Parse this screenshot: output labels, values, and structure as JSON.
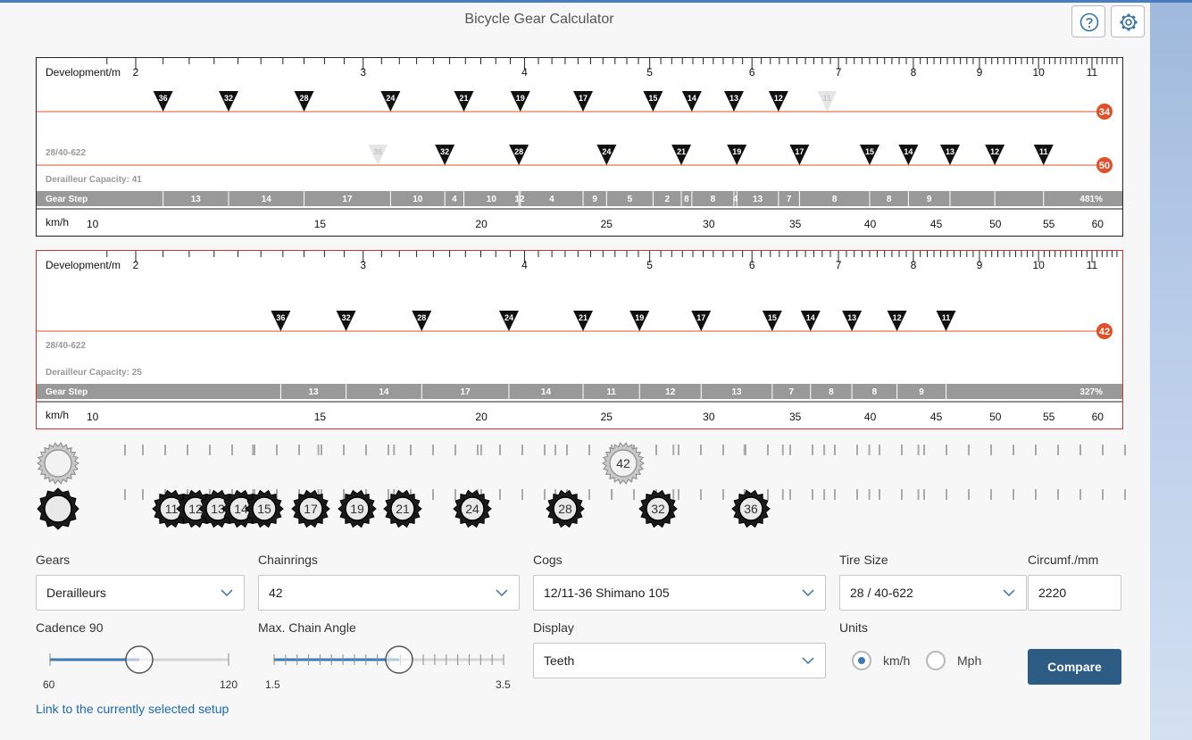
{
  "window": {
    "title": "Bicycle Gear Calculator"
  },
  "header": {
    "help_icon": "question-circle-icon",
    "settings_icon": "gear-icon"
  },
  "charts": [
    {
      "selected": false,
      "development_label": "Development/m",
      "development_ticks": [
        "2",
        "3",
        "4",
        "5",
        "6",
        "7",
        "8",
        "9",
        "10",
        "11"
      ],
      "rings": [
        {
          "label": "34",
          "cogs": [
            {
              "t": "36",
              "dev": 2.1,
              "faded": false
            },
            {
              "t": "32",
              "dev": 2.36,
              "faded": false
            },
            {
              "t": "28",
              "dev": 2.7,
              "faded": false
            },
            {
              "t": "24",
              "dev": 3.15,
              "faded": false
            },
            {
              "t": "21",
              "dev": 3.59,
              "faded": false
            },
            {
              "t": "19",
              "dev": 3.97,
              "faded": false
            },
            {
              "t": "17",
              "dev": 4.44,
              "faded": false
            },
            {
              "t": "15",
              "dev": 5.03,
              "faded": false
            },
            {
              "t": "14",
              "dev": 5.39,
              "faded": false
            },
            {
              "t": "13",
              "dev": 5.81,
              "faded": false
            },
            {
              "t": "12",
              "dev": 6.29,
              "faded": false
            },
            {
              "t": "11",
              "dev": 6.86,
              "faded": true
            }
          ]
        },
        {
          "label": "50",
          "cogs": [
            {
              "t": "36",
              "dev": 3.08,
              "faded": true
            },
            {
              "t": "32",
              "dev": 3.47,
              "faded": false
            },
            {
              "t": "28",
              "dev": 3.96,
              "faded": false
            },
            {
              "t": "24",
              "dev": 4.63,
              "faded": false
            },
            {
              "t": "21",
              "dev": 5.29,
              "faded": false
            },
            {
              "t": "19",
              "dev": 5.84,
              "faded": false
            },
            {
              "t": "17",
              "dev": 6.53,
              "faded": false
            },
            {
              "t": "15",
              "dev": 7.4,
              "faded": false
            },
            {
              "t": "14",
              "dev": 7.93,
              "faded": false
            },
            {
              "t": "13",
              "dev": 8.54,
              "faded": false
            },
            {
              "t": "12",
              "dev": 9.25,
              "faded": false
            },
            {
              "t": "11",
              "dev": 10.09,
              "faded": false
            }
          ]
        }
      ],
      "setup_label": "28/40-622",
      "capacity_label": "Derailleur Capacity: 41",
      "gear_step_label": "Gear Step",
      "gear_steps": [
        "13",
        "14",
        "17",
        "10",
        "4",
        "10",
        "12",
        "4",
        "9",
        "5",
        "2",
        "8",
        "8",
        "4",
        "13",
        "7",
        "8",
        "8",
        "9"
      ],
      "gear_step_total": "481%",
      "speed_label": "km/h",
      "speed_ticks": [
        "10",
        "15",
        "20",
        "25",
        "30",
        "35",
        "40",
        "45",
        "50",
        "55",
        "60"
      ]
    },
    {
      "selected": true,
      "development_label": "Development/m",
      "development_ticks": [
        "2",
        "3",
        "4",
        "5",
        "6",
        "7",
        "8",
        "9",
        "10",
        "11"
      ],
      "rings": [
        {
          "label": "42",
          "cogs": [
            {
              "t": "36",
              "dev": 2.59,
              "faded": false
            },
            {
              "t": "32",
              "dev": 2.91,
              "faded": false
            },
            {
              "t": "28",
              "dev": 3.33,
              "faded": false
            },
            {
              "t": "24",
              "dev": 3.89,
              "faded": false
            },
            {
              "t": "21",
              "dev": 4.44,
              "faded": false
            },
            {
              "t": "19",
              "dev": 4.91,
              "faded": false
            },
            {
              "t": "17",
              "dev": 5.48,
              "faded": false
            },
            {
              "t": "15",
              "dev": 6.22,
              "faded": false
            },
            {
              "t": "14",
              "dev": 6.66,
              "faded": false
            },
            {
              "t": "13",
              "dev": 7.17,
              "faded": false
            },
            {
              "t": "12",
              "dev": 7.77,
              "faded": false
            },
            {
              "t": "11",
              "dev": 8.48,
              "faded": false
            }
          ]
        }
      ],
      "setup_label": "28/40-622",
      "capacity_label": "Derailleur Capacity: 25",
      "gear_step_label": "Gear Step",
      "gear_steps": [
        "13",
        "14",
        "17",
        "14",
        "11",
        "12",
        "13",
        "7",
        "8",
        "8",
        "9"
      ],
      "gear_step_total": "327%",
      "speed_label": "km/h",
      "speed_ticks": [
        "10",
        "15",
        "20",
        "25",
        "30",
        "35",
        "40",
        "45",
        "50",
        "55",
        "60"
      ]
    }
  ],
  "visualization": {
    "chainring": "42",
    "cogs": [
      "11",
      "12",
      "13",
      "14",
      "15",
      "17",
      "19",
      "21",
      "24",
      "28",
      "32",
      "36"
    ]
  },
  "controls": {
    "gears": {
      "label": "Gears",
      "value": "Derailleurs"
    },
    "chainrings": {
      "label": "Chainrings",
      "value": "42"
    },
    "cogs": {
      "label": "Cogs",
      "value": "12/11-36 Shimano 105"
    },
    "tire_size": {
      "label": "Tire Size",
      "value": "28 / 40-622"
    },
    "circumference": {
      "label": "Circumf./mm",
      "value": "2220"
    },
    "cadence": {
      "label": "Cadence 90",
      "min": "60",
      "max": "120",
      "value": 90
    },
    "chain_angle": {
      "label": "Max. Chain Angle",
      "min": "1.5",
      "max": "3.5",
      "value": 2.5
    },
    "display": {
      "label": "Display",
      "value": "Teeth"
    },
    "units": {
      "label": "Units",
      "options": [
        "km/h",
        "Mph"
      ],
      "selected": "km/h"
    },
    "compare_label": "Compare",
    "link_label": "Link to the currently selected setup"
  },
  "colors": {
    "accent": "#e0502a",
    "button": "#2c5b84",
    "link": "#1c6aad"
  }
}
